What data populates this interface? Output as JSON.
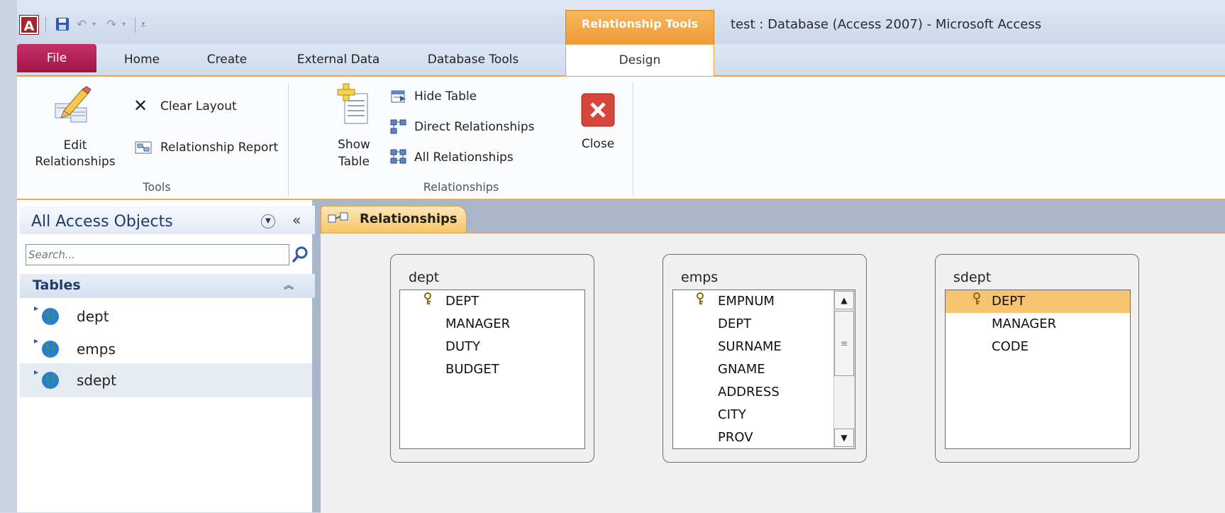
{
  "window": {
    "title": "test : Database (Access 2007)  -  Microsoft Access",
    "context_tab_title": "Relationship Tools",
    "logo_letter": "A"
  },
  "quick_access": {
    "icons": [
      "save-icon",
      "undo-icon",
      "redo-icon",
      "customize-icon"
    ]
  },
  "tabs": {
    "file": "File",
    "home": "Home",
    "create": "Create",
    "external": "External Data",
    "dbtools": "Database Tools",
    "design": "Design"
  },
  "ribbon": {
    "tools_group": {
      "label": "Tools",
      "edit_relationships_line1": "Edit",
      "edit_relationships_line2": "Relationships",
      "clear_layout": "Clear Layout",
      "relationship_report": "Relationship Report"
    },
    "relationships_group": {
      "label": "Relationships",
      "show_table_line1": "Show",
      "show_table_line2": "Table",
      "hide_table": "Hide Table",
      "direct_relationships": "Direct Relationships",
      "all_relationships": "All Relationships",
      "close": "Close"
    }
  },
  "nav": {
    "title": "All Access Objects",
    "search_placeholder": "Search...",
    "section": "Tables",
    "items": [
      "dept",
      "emps",
      "sdept"
    ],
    "selected": "sdept"
  },
  "document": {
    "tab_label": "Relationships"
  },
  "tables": {
    "dept": {
      "title": "dept",
      "fields": [
        "DEPT",
        "MANAGER",
        "DUTY",
        "BUDGET"
      ],
      "key_field": "DEPT"
    },
    "emps": {
      "title": "emps",
      "fields": [
        "EMPNUM",
        "DEPT",
        "SURNAME",
        "GNAME",
        "ADDRESS",
        "CITY",
        "PROV"
      ],
      "key_field": "EMPNUM"
    },
    "sdept": {
      "title": "sdept",
      "fields": [
        "DEPT",
        "MANAGER",
        "CODE"
      ],
      "key_field": "DEPT",
      "selected_field": "DEPT"
    }
  },
  "colors": {
    "file_tab": "#b31b55",
    "context_tab": "#f19a36",
    "selection": "#f6c36e",
    "nav_title": "#1f3b6b"
  }
}
